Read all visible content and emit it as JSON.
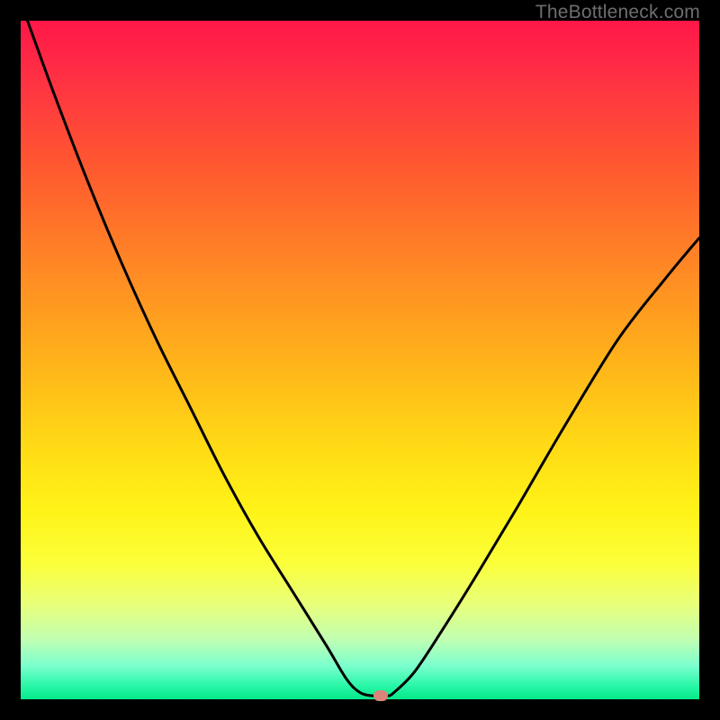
{
  "watermark": "TheBottleneck.com",
  "chart_data": {
    "type": "line",
    "title": "",
    "xlabel": "",
    "ylabel": "",
    "xlim": [
      0,
      100
    ],
    "ylim": [
      0,
      100
    ],
    "background_gradient": {
      "orientation": "vertical",
      "stops": [
        {
          "pos": 0,
          "color": "#ff1748"
        },
        {
          "pos": 22,
          "color": "#ff5a2f"
        },
        {
          "pos": 50,
          "color": "#ffb21a"
        },
        {
          "pos": 72,
          "color": "#fff317"
        },
        {
          "pos": 91,
          "color": "#c3ffb0"
        },
        {
          "pos": 100,
          "color": "#04e989"
        }
      ]
    },
    "series": [
      {
        "name": "bottleneck-curve",
        "x": [
          1,
          5,
          10,
          15,
          20,
          25,
          30,
          35,
          40,
          45,
          48,
          50,
          52,
          54,
          55,
          58,
          62,
          67,
          73,
          80,
          88,
          95,
          100
        ],
        "y": [
          100,
          89,
          76,
          64,
          53,
          43,
          33,
          24,
          16,
          8,
          3,
          1,
          0.5,
          0.5,
          1,
          4,
          10,
          18,
          28,
          40,
          53,
          62,
          68
        ],
        "color": "#000000",
        "stroke_width": 3
      }
    ],
    "marker": {
      "name": "optimal-point",
      "x": 53,
      "y": 0.5,
      "color": "#d98579",
      "shape": "rounded-rect"
    }
  }
}
